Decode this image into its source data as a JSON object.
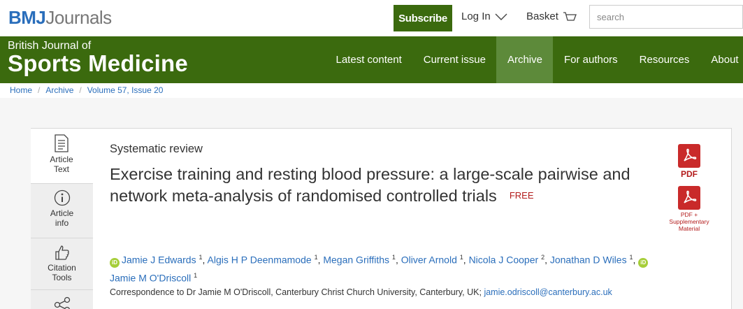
{
  "header": {
    "logo_bmj": "BMJ",
    "logo_journals": "Journals",
    "subscribe_label": "Subscribe",
    "login_label": "Log In",
    "basket_label": "Basket",
    "search_placeholder": "search"
  },
  "journal": {
    "subtitle": "British Journal of",
    "title": "Sports Medicine"
  },
  "nav": {
    "items": [
      {
        "label": "Latest content"
      },
      {
        "label": "Current issue"
      },
      {
        "label": "Archive"
      },
      {
        "label": "For authors"
      },
      {
        "label": "Resources"
      },
      {
        "label": "About"
      }
    ],
    "active": "Archive"
  },
  "breadcrumb": {
    "items": [
      {
        "label": "Home"
      },
      {
        "label": "Archive"
      },
      {
        "label": "Volume 57, Issue 20"
      }
    ]
  },
  "tabs": [
    {
      "label_line1": "Article",
      "label_line2": "Text",
      "icon": "document-icon"
    },
    {
      "label_line1": "Article",
      "label_line2": "info",
      "icon": "info-icon"
    },
    {
      "label_line1": "Citation",
      "label_line2": "Tools",
      "icon": "thumbs-up-icon"
    },
    {
      "label_line1": "",
      "label_line2": "",
      "icon": "share-icon"
    }
  ],
  "article": {
    "type": "Systematic review",
    "title": "Exercise training and resting blood pressure: a large-scale pairwise and network meta-analysis of randomised controlled trials",
    "free_badge": "FREE",
    "authors": [
      {
        "name": "Jamie J Edwards",
        "aff": "1",
        "orcid": true
      },
      {
        "name": "Algis H P Deenmamode",
        "aff": "1",
        "orcid": false
      },
      {
        "name": "Megan Griffiths",
        "aff": "1",
        "orcid": false
      },
      {
        "name": "Oliver Arnold",
        "aff": "1",
        "orcid": false
      },
      {
        "name": "Nicola J Cooper",
        "aff": "2",
        "orcid": false
      },
      {
        "name": "Jonathan D Wiles",
        "aff": "1",
        "orcid": true
      },
      {
        "name": "Jamie M O'Driscoll",
        "aff": "1",
        "orcid": false
      }
    ],
    "correspondence_prefix": "Correspondence to Dr Jamie M O'Driscoll, Canterbury Christ Church University, Canterbury, UK;",
    "correspondence_email": "jamie.odriscoll@canterbury.ac.uk"
  },
  "downloads": {
    "pdf_label": "PDF",
    "pdf_supp_line1": "PDF +",
    "pdf_supp_line2": "Supplementary",
    "pdf_supp_line3": "Material"
  },
  "colors": {
    "brand_green": "#3b6a0e",
    "active_nav": "#5d8a3a",
    "link_blue": "#2a6ebb",
    "pdf_red": "#c92a2a",
    "free_red": "#b31b1b",
    "orcid_green": "#a6ce39"
  }
}
